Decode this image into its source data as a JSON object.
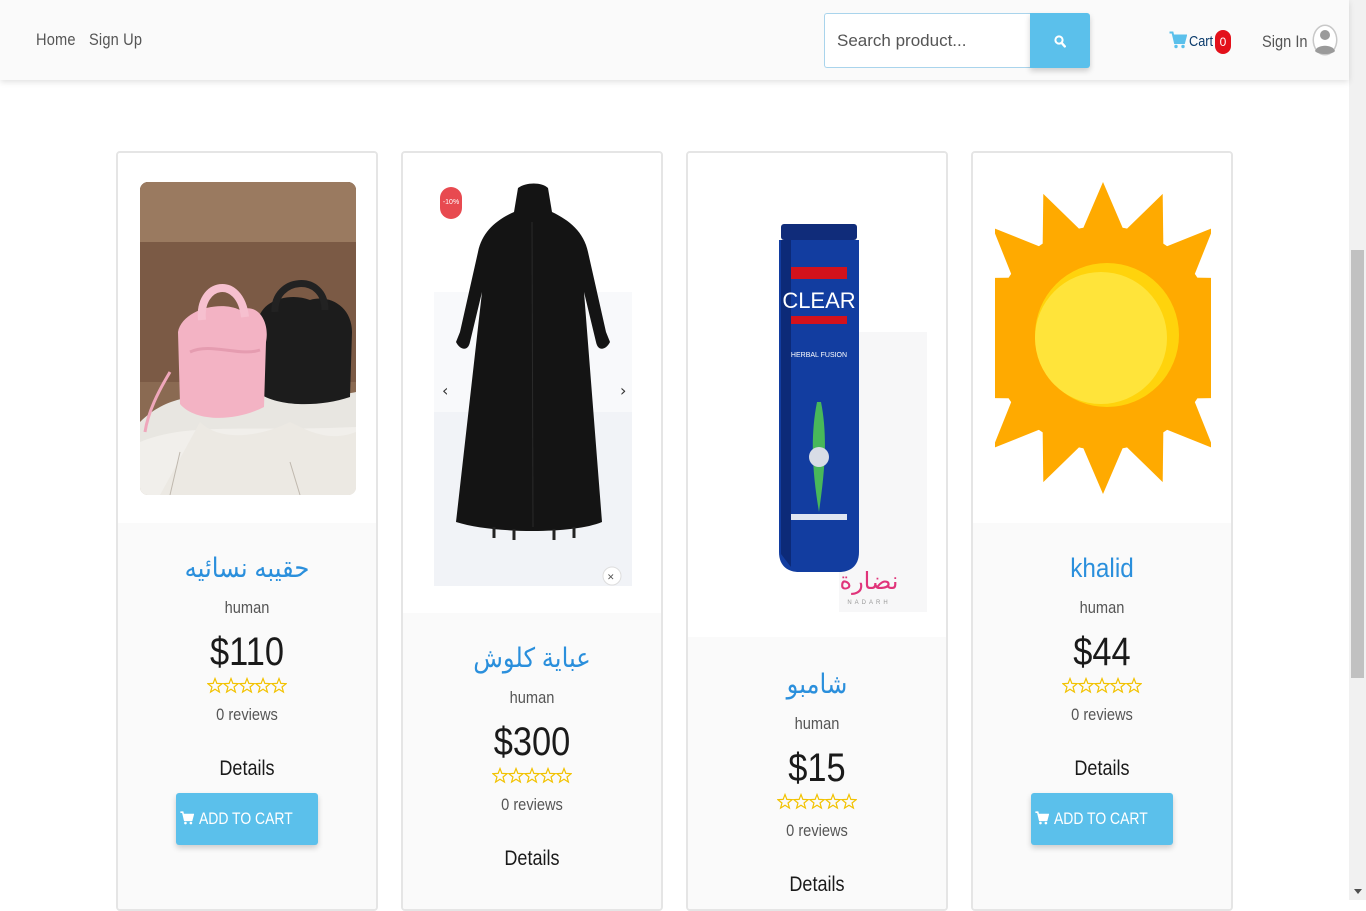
{
  "nav": {
    "home": "Home",
    "signup": "Sign Up",
    "signin": "Sign In"
  },
  "search": {
    "placeholder": "Search product..."
  },
  "cart": {
    "label": "Cart",
    "count": "0"
  },
  "products": [
    {
      "title": "حقيبه نسائيه",
      "category": "human",
      "price": "$110",
      "reviews": "0 reviews",
      "details": "Details",
      "add_to_cart": "ADD TO CART",
      "rating": 0
    },
    {
      "title": "عباية كلوش",
      "category": "human",
      "price": "$300",
      "reviews": "0 reviews",
      "details": "Details",
      "badge": "-10%",
      "rating": 0
    },
    {
      "title": "شامبو",
      "category": "human",
      "price": "$15",
      "reviews": "0 reviews",
      "details": "Details",
      "image_text": {
        "brand": "CLEAR",
        "variant": "HERBAL FUSION",
        "logo": "نضارة",
        "logo_sub": "NADARH"
      },
      "rating": 0
    },
    {
      "title": "khalid",
      "category": "human",
      "price": "$44",
      "reviews": "0 reviews",
      "details": "Details",
      "add_to_cart": "ADD TO CART",
      "rating": 0
    }
  ],
  "colors": {
    "accent": "#5bc0eb",
    "title_blue": "#2a8fdc",
    "badge_red": "#e3101a",
    "star": "#f2c200"
  }
}
